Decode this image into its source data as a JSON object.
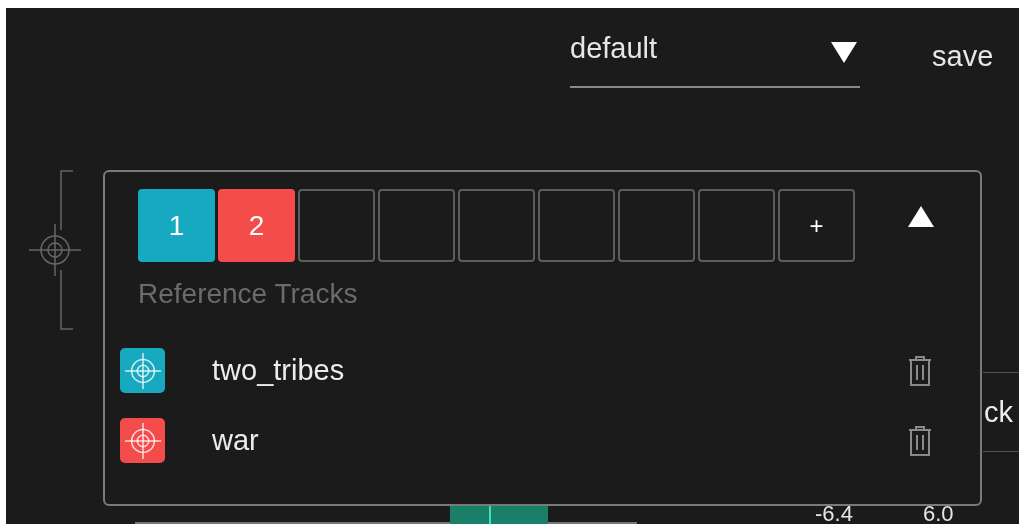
{
  "preset": {
    "value": "default",
    "save_label": "save"
  },
  "balance_button": {
    "label": "ck"
  },
  "scale": [
    "-6.4",
    "6.0"
  ],
  "reference_panel": {
    "expanded": true,
    "title": "Reference Tracks",
    "slots": [
      {
        "kind": "track",
        "label": "1",
        "color": "#17a9bf"
      },
      {
        "kind": "track",
        "label": "2",
        "color": "#f44b4b"
      },
      {
        "kind": "empty"
      },
      {
        "kind": "empty"
      },
      {
        "kind": "empty"
      },
      {
        "kind": "empty"
      },
      {
        "kind": "empty"
      },
      {
        "kind": "empty"
      },
      {
        "kind": "add",
        "label": "+"
      }
    ],
    "tracks": [
      {
        "name": "two_tribes",
        "color": "#17a9bf"
      },
      {
        "name": "war",
        "color": "#f44b4b"
      }
    ]
  }
}
